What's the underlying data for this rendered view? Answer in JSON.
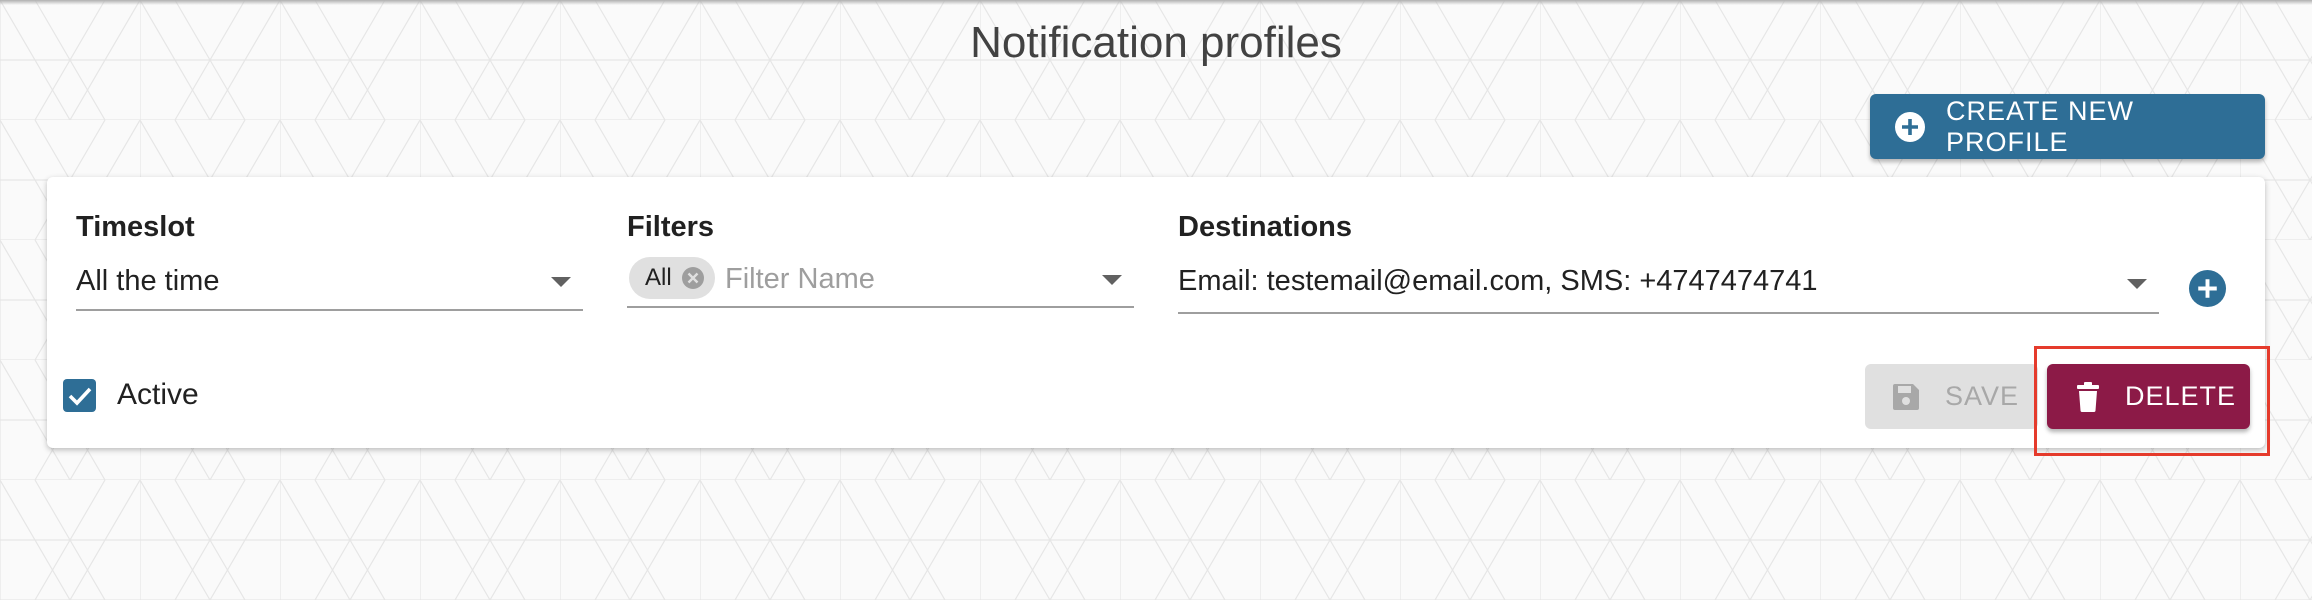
{
  "page": {
    "title": "Notification profiles"
  },
  "actions": {
    "create_label": "CREATE NEW PROFILE"
  },
  "profile": {
    "timeslot": {
      "label": "Timeslot",
      "value": "All the time"
    },
    "filters": {
      "label": "Filters",
      "chip": "All",
      "placeholder": "Filter Name"
    },
    "destinations": {
      "label": "Destinations",
      "value": "Email: testemail@email.com, SMS: +4747474741"
    },
    "active": {
      "label": "Active",
      "checked": true
    },
    "save_label": "SAVE",
    "delete_label": "DELETE"
  },
  "colors": {
    "primary": "#2e6e96",
    "delete": "#8c1a47",
    "disabled_bg": "#e0e0e0",
    "highlight": "#e53b2c"
  },
  "icons": {
    "create": "plus-circle-icon",
    "add_destination": "plus-circle-icon",
    "save": "floppy-disk-icon",
    "delete": "trash-icon",
    "chip_remove": "cancel-circle-icon",
    "dropdown": "caret-down-icon",
    "active": "check-icon"
  }
}
